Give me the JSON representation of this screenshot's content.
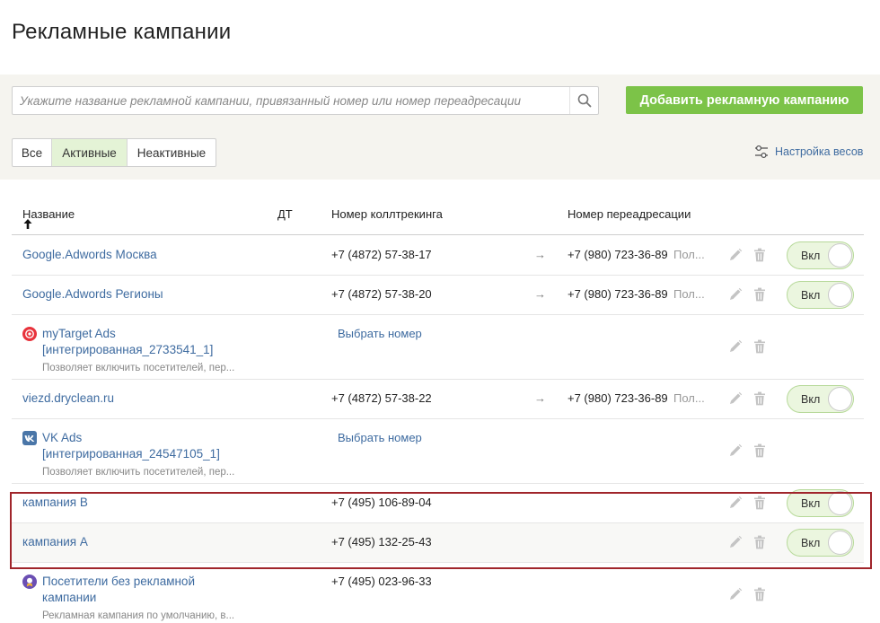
{
  "page": {
    "title": "Рекламные кампании"
  },
  "search": {
    "placeholder": "Укажите название рекламной кампании, привязанный номер или номер переадресации"
  },
  "add_button": "Добавить рекламную кампанию",
  "filters": {
    "all": "Все",
    "active": "Активные",
    "inactive": "Неактивные",
    "selected": "Активные"
  },
  "weights_link": "Настройка весов",
  "table": {
    "columns": {
      "name": "Название",
      "dt": "ДТ",
      "calltracking": "Номер коллтрекинга",
      "redirect": "Номер переадресации"
    },
    "rows": [
      {
        "name": "Google.Adwords Москва",
        "number": "+7 (4872) 57-38-17",
        "arrow": "→",
        "redirect": "+7 (980) 723-36-89",
        "redirect_extra": "Пол...",
        "toggle": "Вкл"
      },
      {
        "name": "Google.Adwords Регионы",
        "number": "+7 (4872) 57-38-20",
        "arrow": "→",
        "redirect": "+7 (980) 723-36-89",
        "redirect_extra": "Пол...",
        "toggle": "Вкл"
      },
      {
        "name": "myTarget Ads [интегрированная_2733541_1]",
        "description": "Позволяет включить посетителей, пер...",
        "action": "Выбрать номер",
        "icon": "mytarget-icon",
        "color": "#e8333c"
      },
      {
        "name": "viezd.dryclean.ru",
        "number": "+7 (4872) 57-38-22",
        "arrow": "→",
        "redirect": "+7 (980) 723-36-89",
        "redirect_extra": "Пол...",
        "toggle": "Вкл"
      },
      {
        "name": "VK Ads [интегрированная_24547105_1]",
        "description": "Позволяет включить посетителей, пер...",
        "action": "Выбрать номер",
        "icon": "vk-icon",
        "color": "#4a76a8"
      },
      {
        "name": "кампания В",
        "number": "+7 (495) 106-89-04",
        "toggle": "Вкл"
      },
      {
        "name": "кампания А",
        "number": "+7 (495) 132-25-43",
        "toggle": "Вкл"
      },
      {
        "name": "Посетители без рекламной кампании",
        "number": "+7 (495) 023-96-33",
        "description": "Рекламная кампания по умолчанию, в...",
        "icon": "default-campaign-icon",
        "color": "#6b4fb3"
      }
    ]
  },
  "colors": {
    "accent_green": "#7cc348",
    "link_blue": "#3e6ba0",
    "highlight_red": "#a0252b",
    "toggle_bg": "#ebf6df"
  }
}
